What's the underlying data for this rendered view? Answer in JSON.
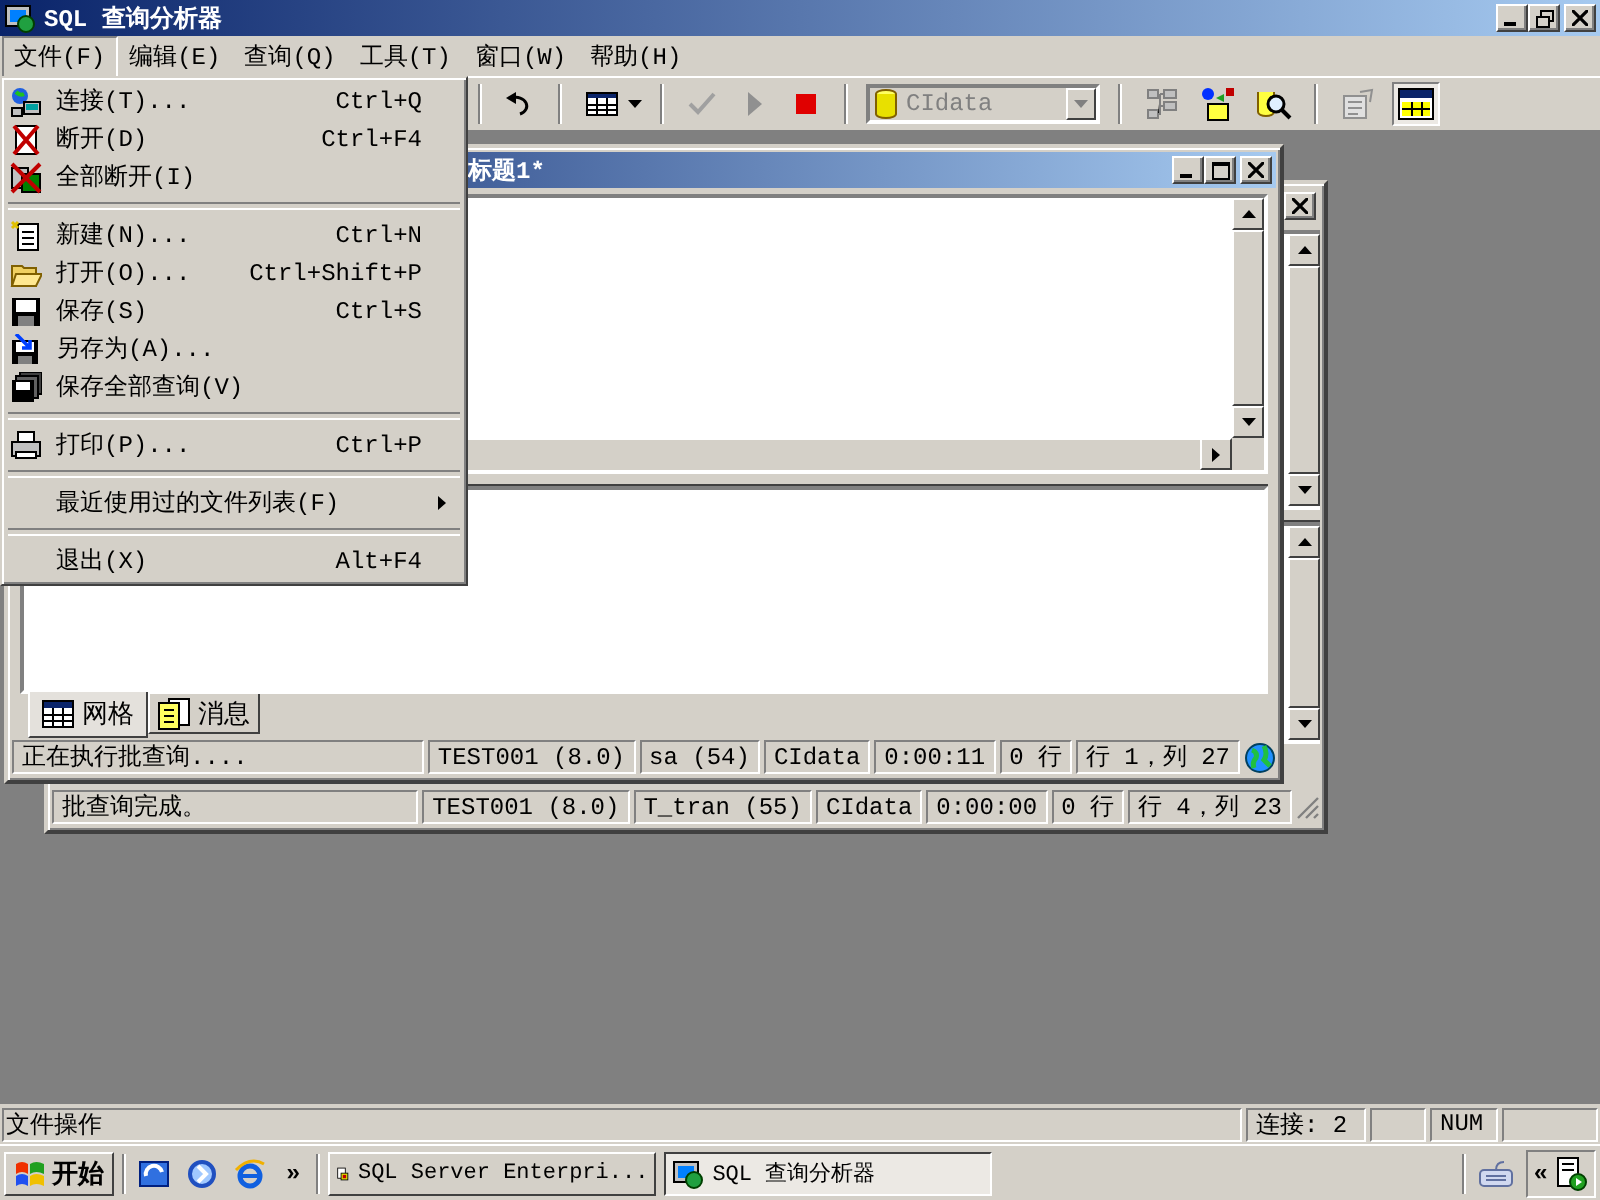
{
  "window": {
    "title": "SQL 查询分析器"
  },
  "menu_bar": [
    {
      "label": "文件(F)",
      "selected": true
    },
    {
      "label": "编辑(E)",
      "selected": false
    },
    {
      "label": "查询(Q)",
      "selected": false
    },
    {
      "label": "工具(T)",
      "selected": false
    },
    {
      "label": "窗口(W)",
      "selected": false
    },
    {
      "label": "帮助(H)",
      "selected": false
    }
  ],
  "file_menu": [
    {
      "kind": "item",
      "label": "连接(T)...",
      "shortcut": "Ctrl+Q"
    },
    {
      "kind": "item",
      "label": "断开(D)",
      "shortcut": "Ctrl+F4"
    },
    {
      "kind": "item",
      "label": "全部断开(I)"
    },
    {
      "kind": "separator"
    },
    {
      "kind": "item",
      "label": "新建(N)...",
      "shortcut": "Ctrl+N"
    },
    {
      "kind": "item",
      "label": "打开(O)...",
      "shortcut": "Ctrl+Shift+P"
    },
    {
      "kind": "item",
      "label": "保存(S)",
      "shortcut": "Ctrl+S"
    },
    {
      "kind": "item",
      "label": "另存为(A)..."
    },
    {
      "kind": "item",
      "label": "保存全部查询(V)"
    },
    {
      "kind": "separator"
    },
    {
      "kind": "item",
      "label": "打印(P)...",
      "shortcut": "Ctrl+P"
    },
    {
      "kind": "separator"
    },
    {
      "kind": "submenu",
      "label": "最近使用过的文件列表(F)"
    },
    {
      "kind": "separator"
    },
    {
      "kind": "item",
      "label": "退出(X)",
      "shortcut": "Alt+F4"
    }
  ],
  "toolbar": {
    "database": "CIdata",
    "database_disabled": true,
    "results_toggle_pressed": true
  },
  "back_window": {
    "status_message": "批查询完成。",
    "status_fields": [
      "TEST001 (8.0)",
      "T_tran (55)",
      "CIdata",
      "0:00:00",
      "0 行",
      "行 4，列 23"
    ]
  },
  "front_window": {
    "title": "标题1*",
    "result_tabs": [
      {
        "label": "网格",
        "selected": true
      },
      {
        "label": "消息",
        "selected": false
      }
    ],
    "status_message": "正在执行批查询....",
    "status_fields": [
      "TEST001 (8.0)",
      "sa (54)",
      "CIdata",
      "0:00:11",
      "0 行",
      "行 1，列 27"
    ]
  },
  "status_bar": {
    "message": "文件操作",
    "connection": "连接: 2",
    "num": "NUM"
  },
  "taskbar": {
    "start": "开始",
    "more": "»",
    "tasks": [
      {
        "label": "SQL Server Enterpri...",
        "selected": false
      },
      {
        "label": "SQL 查询分析器",
        "selected": true
      }
    ],
    "tray_toggle": "«"
  }
}
